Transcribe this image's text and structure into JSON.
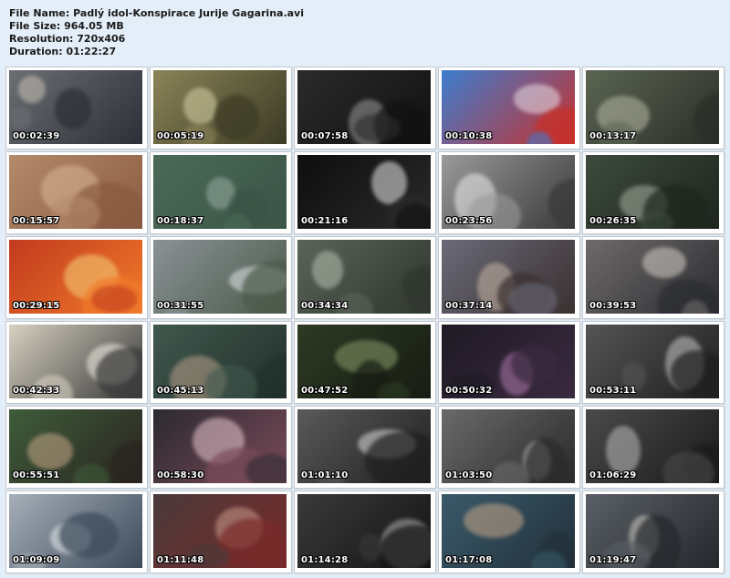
{
  "file_info": {
    "file_name": "File Name: Padlý idol-Konspirace Jurije Gagarina.avi",
    "file_size": "File Size: 964.05 MB",
    "resolution": "Resolution: 720x406",
    "duration": "Duration: 01:22:27"
  },
  "thumbnails": [
    {
      "time": "00:02:39",
      "scene": "presenter-in-lab",
      "bg": "#6b6f73",
      "fg": "#2b2f36",
      "hi": "#c9c2b6"
    },
    {
      "time": "00:05:19",
      "scene": "office-meeting",
      "bg": "#8a8458",
      "fg": "#3b3a24",
      "hi": "#d8d4a8"
    },
    {
      "time": "00:07:58",
      "scene": "crowd-black-white",
      "bg": "#2b2b2b",
      "fg": "#111111",
      "hi": "#9a9a9a"
    },
    {
      "time": "00:10:38",
      "scene": "rocket-launch-painting",
      "bg": "#3d7dd0",
      "fg": "#c8302a",
      "hi": "#e8e0e8"
    },
    {
      "time": "00:13:17",
      "scene": "men-portrait",
      "bg": "#5b6552",
      "fg": "#2a2e28",
      "hi": "#b8b9a6"
    },
    {
      "time": "00:15:57",
      "scene": "rocket-smoke",
      "bg": "#b48b6b",
      "fg": "#8a5a40",
      "hi": "#d9b89a"
    },
    {
      "time": "00:18:37",
      "scene": "green-sky-object",
      "bg": "#4b6a58",
      "fg": "#3a5446",
      "hi": "#9aaea2"
    },
    {
      "time": "00:21:16",
      "scene": "satellite-in-space",
      "bg": "#0e0e0e",
      "fg": "#2a2a2a",
      "hi": "#e8e8e8"
    },
    {
      "time": "00:23:56",
      "scene": "medical-check",
      "bg": "#9a9a9a",
      "fg": "#3a3a3a",
      "hi": "#efefef"
    },
    {
      "time": "00:26:35",
      "scene": "rocket-on-pad",
      "bg": "#3d4a3d",
      "fg": "#1e261e",
      "hi": "#a6b0a0"
    },
    {
      "time": "00:29:15",
      "scene": "fire-explosion",
      "bg": "#c23a1e",
      "fg": "#f07a2a",
      "hi": "#f7d27a"
    },
    {
      "time": "00:31:55",
      "scene": "launch-tower-field",
      "bg": "#8a9296",
      "fg": "#4b5a4a",
      "hi": "#e4e8ea"
    },
    {
      "time": "00:34:34",
      "scene": "control-panel",
      "bg": "#5a6458",
      "fg": "#2f362e",
      "hi": "#b9c0b2"
    },
    {
      "time": "00:37:14",
      "scene": "cosmonaut-helmet",
      "bg": "#6a6a78",
      "fg": "#3a3030",
      "hi": "#c8b8a6"
    },
    {
      "time": "00:39:53",
      "scene": "interview-lab",
      "bg": "#6f6a6a",
      "fg": "#2a2c30",
      "hi": "#d4cec6"
    },
    {
      "time": "00:42:33",
      "scene": "cartoon-strip",
      "bg": "#d6d0c0",
      "fg": "#3a3a3a",
      "hi": "#f4f0e6"
    },
    {
      "time": "00:45:13",
      "scene": "interview-map",
      "bg": "#40584e",
      "fg": "#22302a",
      "hi": "#b9a08a"
    },
    {
      "time": "00:47:52",
      "scene": "crowd-waving",
      "bg": "#2e3a24",
      "fg": "#161c12",
      "hi": "#8a9a6a"
    },
    {
      "time": "00:50:32",
      "scene": "night-lights",
      "bg": "#1f1a24",
      "fg": "#3a2a40",
      "hi": "#b07ab0"
    },
    {
      "time": "00:53:11",
      "scene": "gagarin-microphone",
      "bg": "#555555",
      "fg": "#1f1f1f",
      "hi": "#c6c6c6"
    },
    {
      "time": "00:55:51",
      "scene": "two-men-talking",
      "bg": "#3e5c3a",
      "fg": "#2a2420",
      "hi": "#c8a888"
    },
    {
      "time": "00:58:30",
      "scene": "aerial-explosion",
      "bg": "#2c2a30",
      "fg": "#7a4a5a",
      "hi": "#e8c8d0"
    },
    {
      "time": "01:01:10",
      "scene": "face-closeup",
      "bg": "#5a5a5a",
      "fg": "#1f1f1f",
      "hi": "#dcdcdc"
    },
    {
      "time": "01:03:50",
      "scene": "archive-documents",
      "bg": "#6a6a6a",
      "fg": "#2a2a2a",
      "hi": "#c4c4c4"
    },
    {
      "time": "01:06:29",
      "scene": "men-in-uniform",
      "bg": "#4a4a4a",
      "fg": "#1a1a1a",
      "hi": "#bdbdbd"
    },
    {
      "time": "01:09:09",
      "scene": "airfield-group",
      "bg": "#a6afb8",
      "fg": "#3c4a5a",
      "hi": "#e8eaec"
    },
    {
      "time": "01:11:48",
      "scene": "mountain-town",
      "bg": "#4a3a3a",
      "fg": "#7a2a2a",
      "hi": "#c89a8a"
    },
    {
      "time": "01:14:28",
      "scene": "officials-lineup",
      "bg": "#3a3a3a",
      "fg": "#141414",
      "hi": "#b0b0b0"
    },
    {
      "time": "01:17:08",
      "scene": "interview-map-2",
      "bg": "#3a5a6a",
      "fg": "#22303a",
      "hi": "#c9a88a"
    },
    {
      "time": "01:19:47",
      "scene": "interview-lab-2",
      "bg": "#5a6066",
      "fg": "#24282c",
      "hi": "#d2ccc4"
    }
  ]
}
